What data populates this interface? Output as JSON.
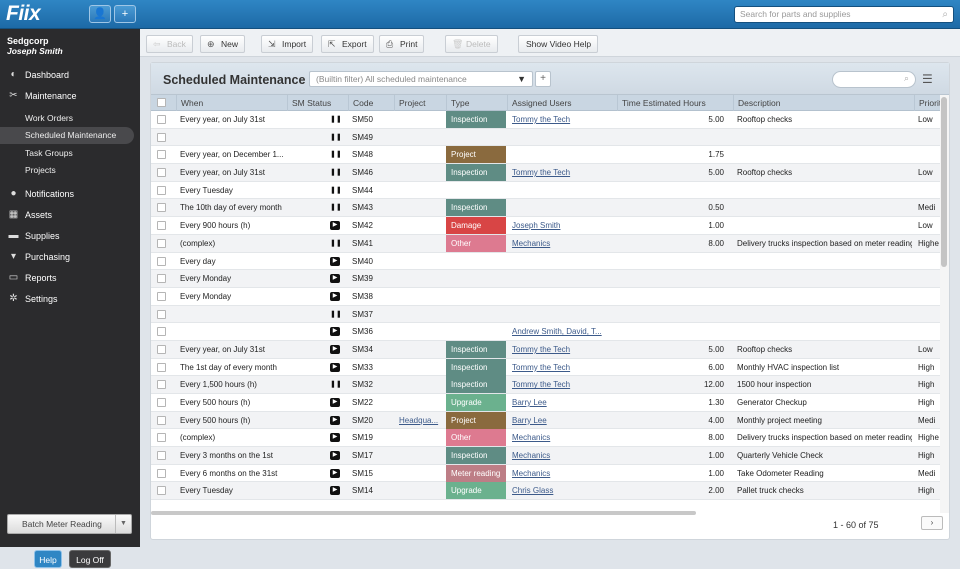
{
  "app": {
    "logo": "Fiix",
    "user_icon": "user-icon",
    "add_icon": "+",
    "search_placeholder": "Search for parts and supplies"
  },
  "sidebar": {
    "org": "Sedgcorp",
    "user": "Joseph Smith",
    "items": [
      {
        "label": "Dashboard",
        "icon": "dashboard-icon",
        "glyph": "◐"
      },
      {
        "label": "Maintenance",
        "icon": "wrench-icon",
        "glyph": "✂"
      },
      {
        "label": "Notifications",
        "icon": "chat-bubble-icon",
        "glyph": "●"
      },
      {
        "label": "Assets",
        "icon": "building-icon",
        "glyph": "▦"
      },
      {
        "label": "Supplies",
        "icon": "truck-icon",
        "glyph": "▬"
      },
      {
        "label": "Purchasing",
        "icon": "cart-icon",
        "glyph": "▾"
      },
      {
        "label": "Reports",
        "icon": "chart-icon",
        "glyph": "▭"
      },
      {
        "label": "Settings",
        "icon": "gear-icon",
        "glyph": "✲"
      }
    ],
    "subitems": [
      "Work Orders",
      "Scheduled Maintenance",
      "Task Groups",
      "Projects"
    ],
    "batch_label": "Batch Meter Reading",
    "help": "Help",
    "logoff": "Log Off"
  },
  "toolbar": {
    "back": "Back",
    "new": "New",
    "import": "Import",
    "export": "Export",
    "print": "Print",
    "delete": "Delete",
    "video": "Show Video Help"
  },
  "panel": {
    "title": "Scheduled Maintenance",
    "filter": "(Builtin filter) All scheduled maintenance",
    "columns": [
      "When",
      "SM Status",
      "Code",
      "Project",
      "Type",
      "Assigned Users",
      "Time Estimated Hours",
      "Description",
      "Priority"
    ],
    "pager": "1 - 60 of 75"
  },
  "colors": {
    "Inspection": "#5f8c84",
    "Project": "#8a6a3e",
    "Damage": "#d84545",
    "Other": "#dd7a90",
    "Upgrade": "#6bb18e",
    "Meter reading": "#bd7e86"
  },
  "rows": [
    {
      "when": "Every year, on July 31st",
      "status": "pause",
      "code": "SM50",
      "project": "",
      "type": "Inspection",
      "users": "Tommy the Tech",
      "hours": "5.00",
      "desc": "Rooftop checks",
      "priority": "Low"
    },
    {
      "when": "",
      "status": "pause",
      "code": "SM49",
      "project": "",
      "type": "",
      "users": "",
      "hours": "",
      "desc": "",
      "priority": ""
    },
    {
      "when": "Every year, on December 1...",
      "status": "pause",
      "code": "SM48",
      "project": "",
      "type": "Project",
      "users": "",
      "hours": "1.75",
      "desc": "",
      "priority": ""
    },
    {
      "when": "Every year, on July 31st",
      "status": "pause",
      "code": "SM46",
      "project": "",
      "type": "Inspection",
      "users": "Tommy the Tech",
      "hours": "5.00",
      "desc": "Rooftop checks",
      "priority": "Low"
    },
    {
      "when": "Every Tuesday",
      "status": "pause",
      "code": "SM44",
      "project": "",
      "type": "",
      "users": "",
      "hours": "",
      "desc": "",
      "priority": ""
    },
    {
      "when": "The 10th day of every month",
      "status": "pause",
      "code": "SM43",
      "project": "",
      "type": "Inspection",
      "users": "",
      "hours": "0.50",
      "desc": "",
      "priority": "Medi"
    },
    {
      "when": "Every 900 hours (h)",
      "status": "play",
      "code": "SM42",
      "project": "",
      "type": "Damage",
      "users": "Joseph Smith",
      "hours": "1.00",
      "desc": "",
      "priority": "Low"
    },
    {
      "when": "(complex)",
      "status": "pause",
      "code": "SM41",
      "project": "",
      "type": "Other",
      "users": "Mechanics",
      "hours": "8.00",
      "desc": "Delivery trucks inspection based on meter readings",
      "priority": "Highe"
    },
    {
      "when": "Every day",
      "status": "play",
      "code": "SM40",
      "project": "",
      "type": "",
      "users": "",
      "hours": "",
      "desc": "",
      "priority": ""
    },
    {
      "when": "Every Monday",
      "status": "play",
      "code": "SM39",
      "project": "",
      "type": "",
      "users": "",
      "hours": "",
      "desc": "",
      "priority": ""
    },
    {
      "when": "Every Monday",
      "status": "play",
      "code": "SM38",
      "project": "",
      "type": "",
      "users": "",
      "hours": "",
      "desc": "",
      "priority": ""
    },
    {
      "when": "",
      "status": "pause",
      "code": "SM37",
      "project": "",
      "type": "",
      "users": "",
      "hours": "",
      "desc": "",
      "priority": ""
    },
    {
      "when": "",
      "status": "play",
      "code": "SM36",
      "project": "",
      "type": "",
      "users": "Andrew Smith, David, T...",
      "hours": "",
      "desc": "",
      "priority": ""
    },
    {
      "when": "Every year, on July 31st",
      "status": "play",
      "code": "SM34",
      "project": "",
      "type": "Inspection",
      "users": "Tommy the Tech",
      "hours": "5.00",
      "desc": "Rooftop checks",
      "priority": "Low"
    },
    {
      "when": "The 1st day of every month",
      "status": "play",
      "code": "SM33",
      "project": "",
      "type": "Inspection",
      "users": "Tommy the Tech",
      "hours": "6.00",
      "desc": "Monthly HVAC inspection list",
      "priority": "High"
    },
    {
      "when": "Every 1,500 hours (h)",
      "status": "pause",
      "code": "SM32",
      "project": "",
      "type": "Inspection",
      "users": "Tommy the Tech",
      "hours": "12.00",
      "desc": "1500 hour inspection",
      "priority": "High"
    },
    {
      "when": "Every 500 hours (h)",
      "status": "play",
      "code": "SM22",
      "project": "",
      "type": "Upgrade",
      "users": "Barry Lee",
      "hours": "1.30",
      "desc": "Generator Checkup",
      "priority": "High"
    },
    {
      "when": "Every 500 hours (h)",
      "status": "play",
      "code": "SM20",
      "project": "Headqua...",
      "type": "Project",
      "users": "Barry Lee",
      "hours": "4.00",
      "desc": "Monthly project meeting",
      "priority": "Medi"
    },
    {
      "when": "(complex)",
      "status": "play",
      "code": "SM19",
      "project": "",
      "type": "Other",
      "users": "Mechanics",
      "hours": "8.00",
      "desc": "Delivery trucks inspection based on meter readings",
      "priority": "Highe"
    },
    {
      "when": "Every 3 months on the 1st",
      "status": "play",
      "code": "SM17",
      "project": "",
      "type": "Inspection",
      "users": "Mechanics",
      "hours": "1.00",
      "desc": "Quarterly Vehicle Check",
      "priority": "High"
    },
    {
      "when": "Every 6 months on the 31st",
      "status": "play",
      "code": "SM15",
      "project": "",
      "type": "Meter reading",
      "users": "Mechanics",
      "hours": "1.00",
      "desc": "Take Odometer Reading",
      "priority": "Medi"
    },
    {
      "when": "Every Tuesday",
      "status": "play",
      "code": "SM14",
      "project": "",
      "type": "Upgrade",
      "users": "Chris Glass",
      "hours": "2.00",
      "desc": "Pallet truck checks",
      "priority": "High"
    }
  ]
}
